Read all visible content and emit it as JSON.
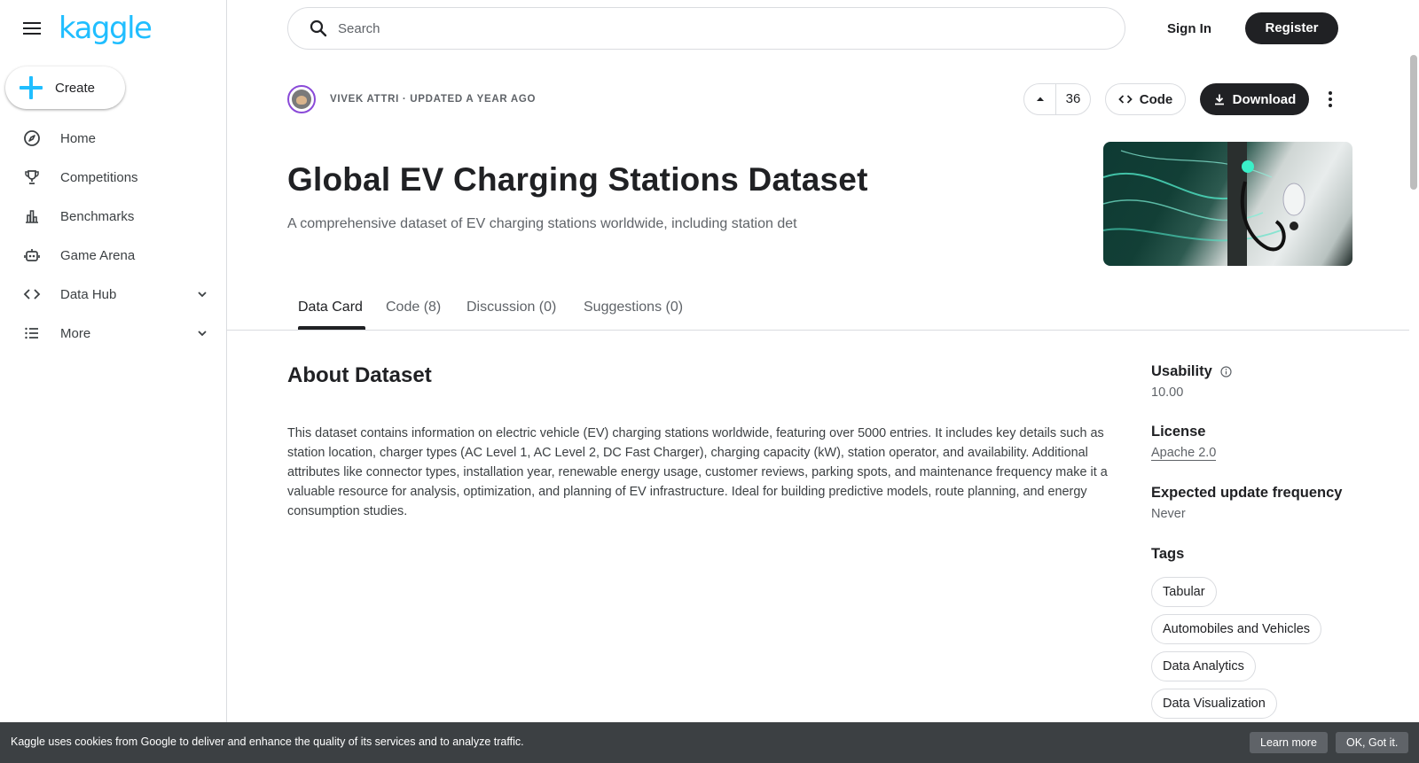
{
  "app": {
    "logo_text": "kaggle",
    "brand_color": "#20beff"
  },
  "sidebar": {
    "menu_icon": "hamburger-icon",
    "create_label": "Create",
    "items": [
      {
        "label": "Home",
        "icon": "compass-icon"
      },
      {
        "label": "Competitions",
        "icon": "trophy-icon"
      },
      {
        "label": "Benchmarks",
        "icon": "bar-chart-icon"
      },
      {
        "label": "Game Arena",
        "icon": "robot-icon"
      },
      {
        "label": "Data Hub",
        "icon": "code-brackets-icon",
        "expandable": true
      },
      {
        "label": "More",
        "icon": "list-icon",
        "expandable": true
      }
    ]
  },
  "topbar": {
    "search_placeholder": "Search",
    "sign_in": "Sign In",
    "register": "Register"
  },
  "dataset": {
    "author_line": "VIVEK ATTRI · UPDATED A YEAR AGO",
    "vote_count": "36",
    "code_label": "Code",
    "download_label": "Download",
    "title": "Global EV Charging Stations Dataset",
    "subtitle": "A comprehensive dataset of EV charging stations worldwide, including station det"
  },
  "tabs": [
    {
      "label": "Data Card",
      "active": true
    },
    {
      "label": "Code (8)",
      "active": false
    },
    {
      "label": "Discussion (0)",
      "active": false
    },
    {
      "label": "Suggestions (0)",
      "active": false
    }
  ],
  "about": {
    "heading": "About Dataset",
    "body": "This dataset contains information on electric vehicle (EV) charging stations worldwide, featuring over 5000 entries. It includes key details such as station location, charger types (AC Level 1, AC Level 2, DC Fast Charger), charging capacity (kW), station operator, and availability. Additional attributes like connector types, installation year, renewable energy usage, customer reviews, parking spots, and maintenance frequency make it a valuable resource for analysis, optimization, and planning of EV infrastructure. Ideal for building predictive models, route planning, and energy consumption studies."
  },
  "meta": {
    "usability_label": "Usability",
    "usability_value": "10.00",
    "license_label": "License",
    "license_value": "Apache 2.0",
    "frequency_label": "Expected update frequency",
    "frequency_value": "Never",
    "tags_label": "Tags",
    "tags": [
      "Tabular",
      "Automobiles and Vehicles",
      "Data Analytics",
      "Data Visualization"
    ]
  },
  "cookie": {
    "message": "Kaggle uses cookies from Google to deliver and enhance the quality of its services and to analyze traffic.",
    "learn_more": "Learn more",
    "ok": "OK, Got it."
  }
}
